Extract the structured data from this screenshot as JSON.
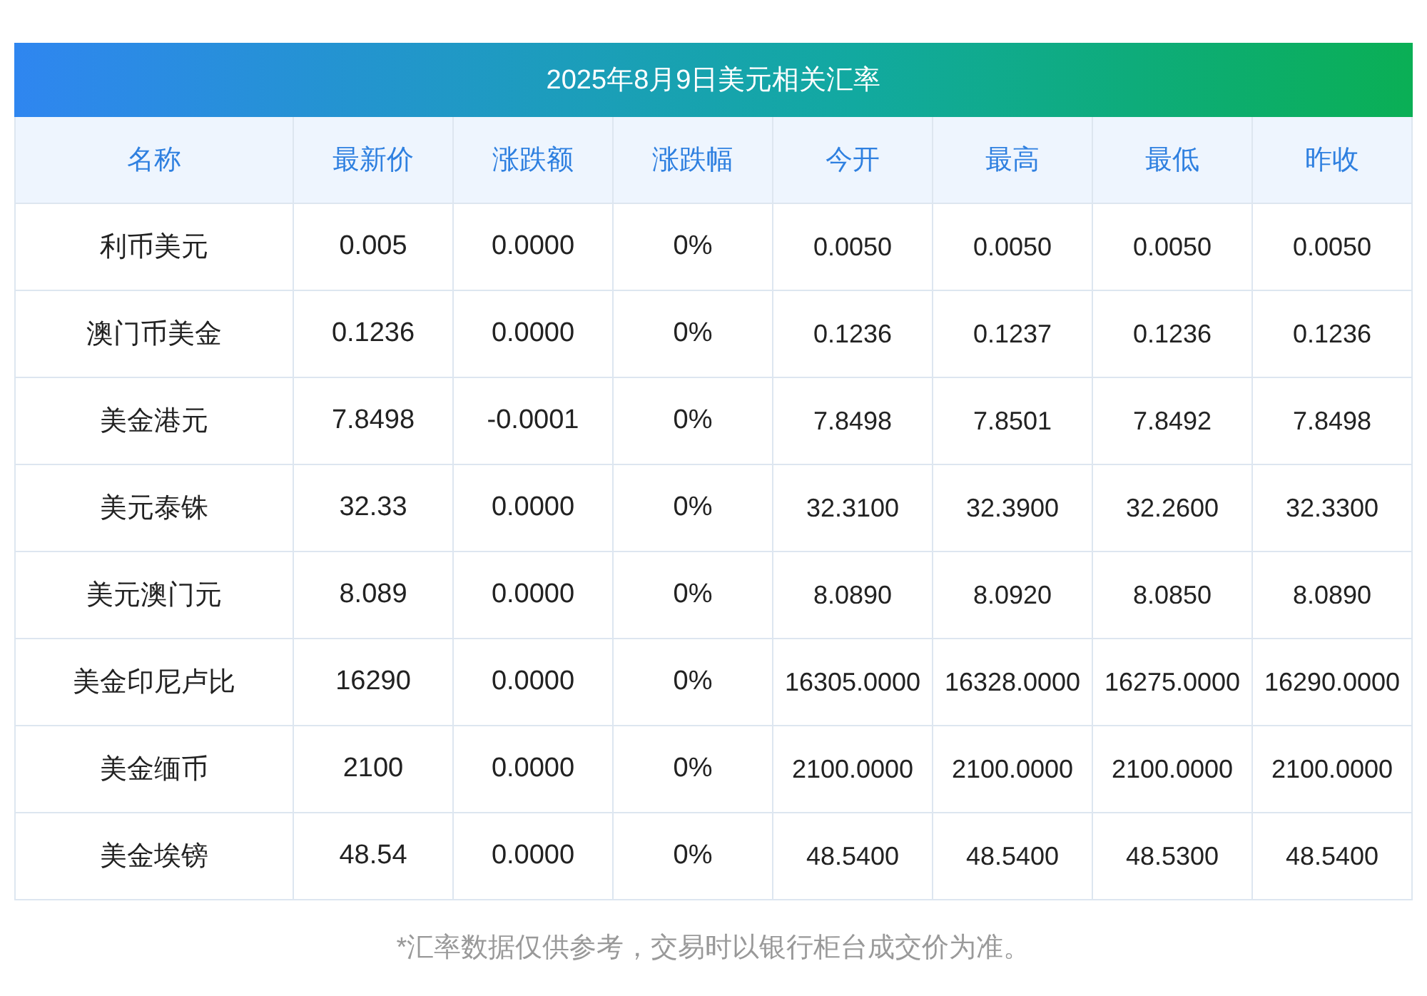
{
  "title": "2025年8月9日美元相关汇率",
  "table": {
    "columns": [
      "名称",
      "最新价",
      "涨跌额",
      "涨跌幅",
      "今开",
      "最高",
      "最低",
      "昨收"
    ],
    "rows": [
      [
        "利币美元",
        "0.005",
        "0.0000",
        "0%",
        "0.0050",
        "0.0050",
        "0.0050",
        "0.0050"
      ],
      [
        "澳门币美金",
        "0.1236",
        "0.0000",
        "0%",
        "0.1236",
        "0.1237",
        "0.1236",
        "0.1236"
      ],
      [
        "美金港元",
        "7.8498",
        "-0.0001",
        "0%",
        "7.8498",
        "7.8501",
        "7.8492",
        "7.8498"
      ],
      [
        "美元泰铢",
        "32.33",
        "0.0000",
        "0%",
        "32.3100",
        "32.3900",
        "32.2600",
        "32.3300"
      ],
      [
        "美元澳门元",
        "8.089",
        "0.0000",
        "0%",
        "8.0890",
        "8.0920",
        "8.0850",
        "8.0890"
      ],
      [
        "美金印尼卢比",
        "16290",
        "0.0000",
        "0%",
        "16305.0000",
        "16328.0000",
        "16275.0000",
        "16290.0000"
      ],
      [
        "美金缅币",
        "2100",
        "0.0000",
        "0%",
        "2100.0000",
        "2100.0000",
        "2100.0000",
        "2100.0000"
      ],
      [
        "美金埃镑",
        "48.54",
        "0.0000",
        "0%",
        "48.5400",
        "48.5400",
        "48.5300",
        "48.5400"
      ]
    ]
  },
  "footnote": "*汇率数据仅供参考，交易时以银行柜台成交价为准。"
}
